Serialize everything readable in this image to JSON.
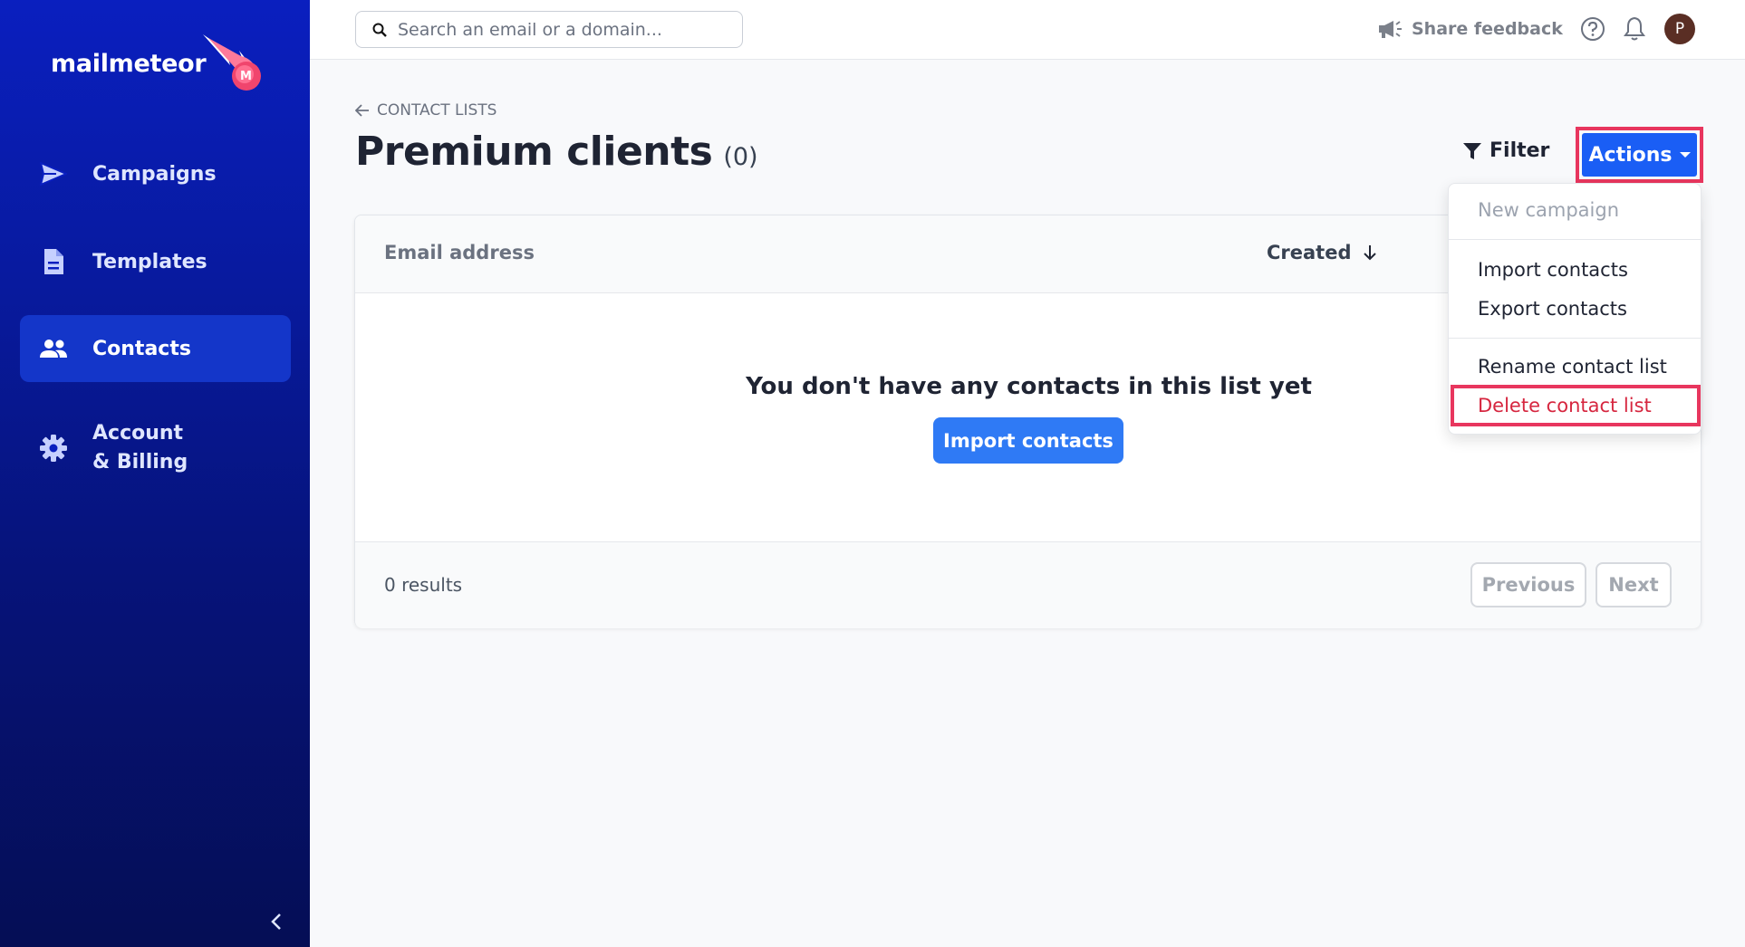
{
  "app": {
    "logo_text": "mailmeteor",
    "brand_color": "#0a1fbf",
    "accent_color": "#1a5ef5",
    "highlight_color": "#e8365e"
  },
  "sidebar": {
    "items": [
      {
        "label": "Campaigns",
        "icon": "paper-plane-icon",
        "active": false
      },
      {
        "label": "Templates",
        "icon": "document-icon",
        "active": false
      },
      {
        "label": "Contacts",
        "icon": "users-icon",
        "active": true
      },
      {
        "label_line1": "Account",
        "label_line2": "& Billing",
        "icon": "gear-icon",
        "active": false
      }
    ],
    "collapse_icon": "chevron-left-icon"
  },
  "topbar": {
    "search_placeholder": "Search an email or a domain...",
    "feedback_label": "Share feedback",
    "avatar_initial": "P"
  },
  "main": {
    "breadcrumb": "CONTACT LISTS",
    "title": "Premium clients",
    "count": "(0)",
    "filter_label": "Filter",
    "actions_label": "Actions"
  },
  "table": {
    "columns": [
      "Email address",
      "Created"
    ],
    "empty_message": "You don't have any contacts in this list yet",
    "import_button": "Import contacts",
    "results": "0 results",
    "previous": "Previous",
    "next": "Next"
  },
  "actions_menu": {
    "items": [
      {
        "label": "New campaign",
        "disabled": true
      },
      {
        "label": "Import contacts",
        "disabled": false
      },
      {
        "label": "Export contacts",
        "disabled": false
      },
      {
        "label": "Rename contact list",
        "disabled": false
      },
      {
        "label": "Delete contact list",
        "disabled": false,
        "destructive": true,
        "highlighted": true
      }
    ]
  }
}
